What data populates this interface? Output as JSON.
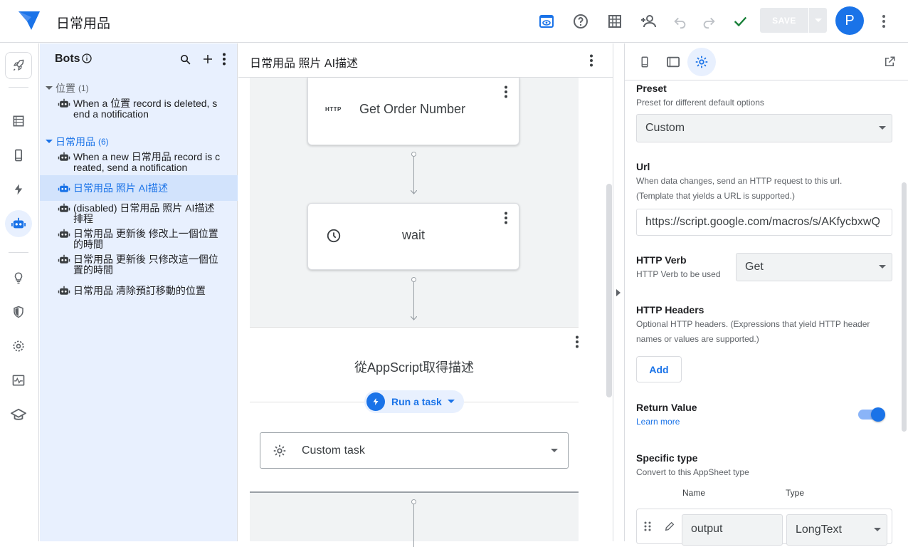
{
  "app": {
    "title": "日常用品",
    "save_label": "SAVE",
    "avatar_letter": "P"
  },
  "colors": {
    "accent": "#1a73e8",
    "success": "#188038",
    "selected_bg": "#d2e3fc",
    "panel_bg": "#e8f0fe"
  },
  "toolbar": {
    "icons": [
      "preview-icon",
      "help-icon",
      "table-view-icon",
      "share-user-icon",
      "undo-icon",
      "redo-icon",
      "check-icon",
      "more-vert-icon"
    ]
  },
  "rail": {
    "icons": [
      "rocket-icon",
      "data-icon",
      "app-icon",
      "action-icon",
      "bot-icon",
      "lightbulb-icon",
      "security-icon",
      "settings-icon",
      "monitor-icon",
      "learn-icon"
    ]
  },
  "bots_panel": {
    "title": "Bots",
    "groups": [
      {
        "label": "位置",
        "count": "(1)",
        "items": [
          "When a 位置 record is deleted, send a notification"
        ]
      },
      {
        "label": "日常用品",
        "count": "(6)",
        "items": [
          "When a new 日常用品 record is created, send a notification",
          "日常用品 照片 AI描述",
          "(disabled) 日常用品 照片 AI描述 排程",
          "日常用品 更新後 修改上一個位置的時間",
          "日常用品 更新後 只修改這一個位置的時間",
          "日常用品 清除預訂移動的位置"
        ]
      }
    ]
  },
  "flow": {
    "title": "日常用品 照片 AI描述",
    "card1": {
      "badge": "HTTP",
      "label": "Get Order Number"
    },
    "card2": {
      "label": "wait"
    },
    "step": {
      "title": "從AppScript取得描述",
      "chip": "Run a task",
      "task_select": "Custom task"
    }
  },
  "props": {
    "preset": {
      "label": "Preset",
      "hint": "Preset for different default options",
      "value": "Custom"
    },
    "url": {
      "label": "Url",
      "hint1": "When data changes, send an HTTP request to this url.",
      "hint2": "(Template that yields a URL is supported.)",
      "value": "https://script.google.com/macros/s/AKfycbxwQ"
    },
    "verb": {
      "label": "HTTP Verb",
      "hint": "HTTP Verb to be used",
      "value": "Get"
    },
    "headers": {
      "label": "HTTP Headers",
      "hint1": "Optional HTTP headers. (Expressions that yield HTTP header",
      "hint2": "names or values are supported.)",
      "add_label": "Add"
    },
    "return_value": {
      "label": "Return Value",
      "link": "Learn more",
      "enabled": true
    },
    "specific_type": {
      "label": "Specific type",
      "hint": "Convert to this AppSheet type",
      "col_name": "Name",
      "col_type": "Type",
      "row_name": "output",
      "row_type": "LongText"
    }
  }
}
